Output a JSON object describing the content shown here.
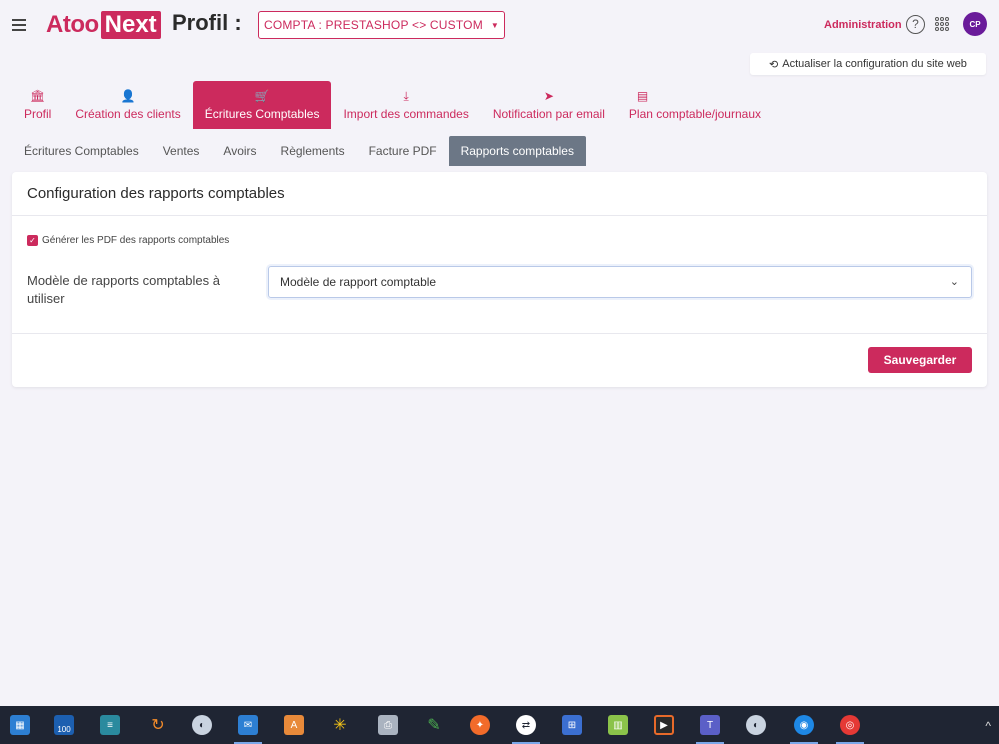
{
  "header": {
    "logo_part1": "Atoo",
    "logo_part2": "Next",
    "page_title": "Profil :",
    "shop_selector": "COMPTA : PRESTASHOP <> CUSTOM",
    "admin_label": "Administration",
    "help_glyph": "?",
    "avatar_initials": "CP"
  },
  "refresh_button": "Actualiser la configuration du site web",
  "main_tabs": [
    {
      "label": "Profil",
      "icon": "bank-icon",
      "active": false
    },
    {
      "label": "Création des clients",
      "icon": "user-icon",
      "active": false
    },
    {
      "label": "Écritures Comptables",
      "icon": "cart-icon",
      "active": true
    },
    {
      "label": "Import des commandes",
      "icon": "download-icon",
      "active": false
    },
    {
      "label": "Notification par email",
      "icon": "send-icon",
      "active": false
    },
    {
      "label": "Plan comptable/journaux",
      "icon": "document-icon",
      "active": false
    }
  ],
  "sub_tabs": [
    {
      "label": "Écritures Comptables",
      "active": false
    },
    {
      "label": "Ventes",
      "active": false
    },
    {
      "label": "Avoirs",
      "active": false
    },
    {
      "label": "Règlements",
      "active": false
    },
    {
      "label": "Facture PDF",
      "active": false
    },
    {
      "label": "Rapports comptables",
      "active": true
    }
  ],
  "card": {
    "title": "Configuration des rapports comptables",
    "checkbox_label": "Générer les PDF des rapports comptables",
    "checkbox_checked": true,
    "field_label": "Modèle de rapports comptables à utiliser",
    "select_value": "Modèle de rapport comptable",
    "save_label": "Sauvegarder"
  },
  "colors": {
    "brand": "#cc2a5d",
    "subtab_active": "#6c7786",
    "background": "#f4f3f9",
    "taskbar": "#1f2533"
  },
  "taskbar": {
    "badge_100": "100",
    "tray_glyph": "^"
  }
}
